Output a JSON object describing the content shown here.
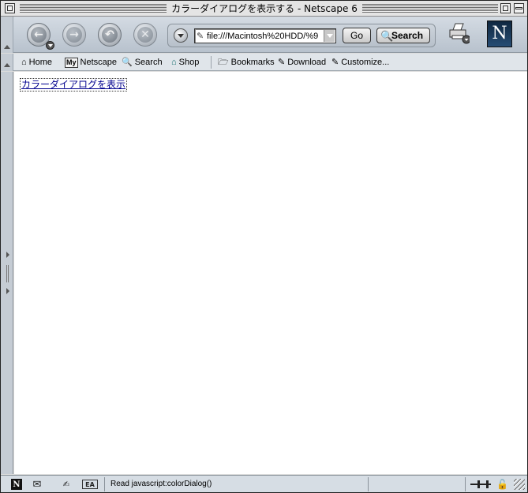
{
  "window": {
    "title": "カラーダイアログを表示する - Netscape 6"
  },
  "toolbar": {
    "back_icon": "back-arrow-icon",
    "forward_icon": "forward-arrow-icon",
    "reload_icon": "reload-icon",
    "stop_icon": "stop-icon",
    "url_value": "file:///Macintosh%20HDD/%9",
    "go_label": "Go",
    "search_label": "Search",
    "logo_letter": "N"
  },
  "personal_toolbar": {
    "items": [
      {
        "label": "Home",
        "icon": "home-icon"
      },
      {
        "label": "Netscape",
        "icon": "my-netscape-icon",
        "badge": "My"
      },
      {
        "label": "Search",
        "icon": "search-icon"
      },
      {
        "label": "Shop",
        "icon": "shop-icon"
      },
      {
        "label": "Bookmarks",
        "icon": "bookmarks-folder-icon"
      },
      {
        "label": "Download",
        "icon": "download-icon"
      },
      {
        "label": "Customize...",
        "icon": "customize-icon"
      }
    ]
  },
  "content": {
    "link_text": "カラーダイアログを表示"
  },
  "status": {
    "logo_letter": "N",
    "composer_label": "EA",
    "text": "Read javascript:colorDialog()"
  },
  "colors": {
    "link": "#00008e",
    "toolbar": "#c5ccd4",
    "logo_bg": "#1a3a5c"
  }
}
